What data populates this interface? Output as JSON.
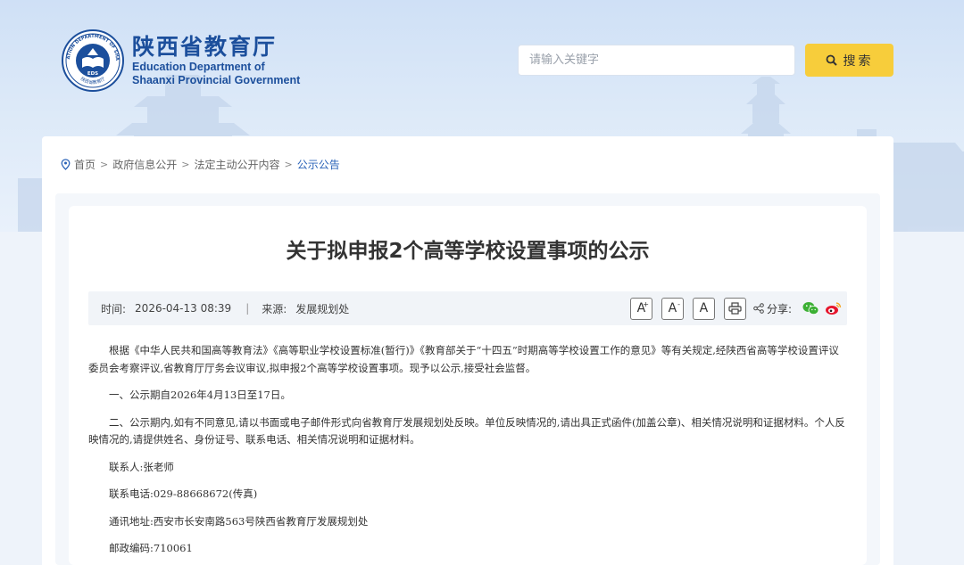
{
  "header": {
    "logo_cn": "陕西省教育厅",
    "logo_en_line1": "Education Department of",
    "logo_en_line2": "Shaanxi Provincial Government",
    "emblem_ring_text": "EDUCATION DEPARTMENT OF SHAANXI",
    "emblem_bottom_text": "陕西省教育厅",
    "emblem_abbr": "EDS",
    "search_placeholder": "请输入关键字",
    "search_button": "搜索"
  },
  "breadcrumb": {
    "items": [
      "首页",
      "政府信息公开",
      "法定主动公开内容",
      "公示公告"
    ],
    "separator": ">"
  },
  "article": {
    "title": "关于拟申报2个高等学校设置事项的公示",
    "time_label": "时间:",
    "time_value": "2026-04-13 08:39",
    "source_label": "来源:",
    "source_value": "发展规划处",
    "font_large": "A",
    "font_small": "A",
    "font_reset": "A",
    "share_label": "分享:",
    "paragraphs": [
      "根据《中华人民共和国高等教育法》《高等职业学校设置标准(暂行)》《教育部关于“十四五”时期高等学校设置工作的意见》等有关规定,经陕西省高等学校设置评议委员会考察评议,省教育厅厅务会议审议,拟申报2个高等学校设置事项。现予以公示,接受社会监督。",
      "一、公示期自2026年4月13日至17日。",
      "二、公示期内,如有不同意见,请以书面或电子邮件形式向省教育厅发展规划处反映。单位反映情况的,请出具正式函件(加盖公章)、相关情况说明和证据材料。个人反映情况的,请提供姓名、身份证号、联系电话、相关情况说明和证据材料。",
      "联系人:张老师",
      "联系电话:029-88668672(传真)",
      "通讯地址:西安市长安南路563号陕西省教育厅发展规划处",
      "邮政编码:710061"
    ]
  },
  "colors": {
    "brand_blue": "#1c4f9c",
    "search_yellow": "#f7cd3b",
    "breadcrumb_active": "#2a63b8",
    "wechat_green": "#3cb034",
    "weibo_red": "#e6162d"
  },
  "icons": [
    "location-icon",
    "search-icon",
    "font-increase-icon",
    "font-decrease-icon",
    "font-reset-icon",
    "print-icon",
    "share-icon",
    "wechat-icon",
    "weibo-icon"
  ]
}
